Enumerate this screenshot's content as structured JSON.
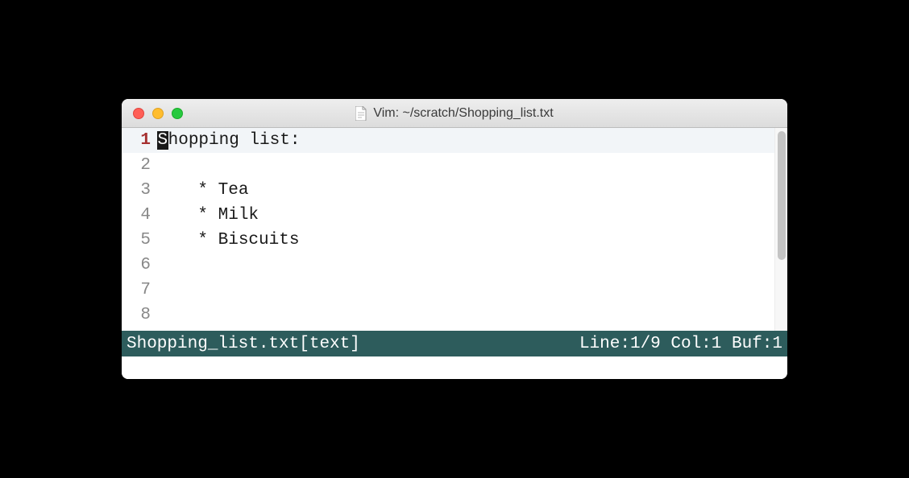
{
  "window": {
    "title": "Vim: ~/scratch/Shopping_list.txt"
  },
  "editor": {
    "current_line_index": 0,
    "lines": [
      {
        "num": "1",
        "cursor_ch": "S",
        "rest": "hopping list:"
      },
      {
        "num": "2",
        "text": ""
      },
      {
        "num": "3",
        "text": "    * Tea"
      },
      {
        "num": "4",
        "text": "    * Milk"
      },
      {
        "num": "5",
        "text": "    * Biscuits"
      },
      {
        "num": "6",
        "text": ""
      },
      {
        "num": "7",
        "text": ""
      },
      {
        "num": "8",
        "text": ""
      }
    ]
  },
  "status": {
    "left": "Shopping_list.txt[text]",
    "right": "Line:1/9 Col:1 Buf:1"
  }
}
